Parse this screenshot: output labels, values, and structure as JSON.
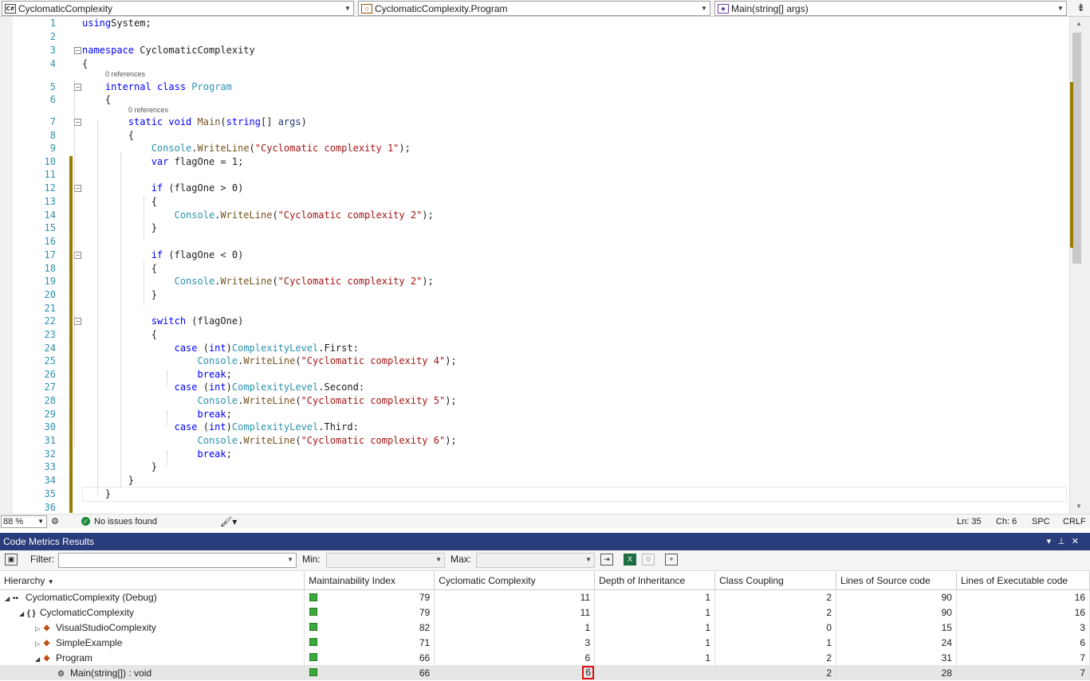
{
  "navbar": {
    "project": "CyclomaticComplexity",
    "project_icon": "C#",
    "type": "CyclomaticComplexity.Program",
    "member": "Main(string[] args)"
  },
  "code": {
    "reference_label": "0 references",
    "lines": [
      {
        "n": "1",
        "t": [
          [
            "kw",
            "using"
          ],
          [
            "",
            "System;"
          ]
        ]
      },
      {
        "n": "2",
        "t": []
      },
      {
        "n": "3",
        "t": [
          [
            "kw",
            "namespace"
          ],
          [
            "",
            " CyclomaticComplexity"
          ]
        ]
      },
      {
        "n": "4",
        "t": [
          [
            "",
            "{"
          ]
        ]
      },
      {
        "n": "5",
        "t": [
          [
            "",
            "    "
          ],
          [
            "kw",
            "internal class"
          ],
          [
            "",
            " "
          ],
          [
            "ty",
            "Program"
          ]
        ]
      },
      {
        "n": "6",
        "t": [
          [
            "",
            "    {"
          ]
        ]
      },
      {
        "n": "7",
        "t": [
          [
            "",
            "        "
          ],
          [
            "kw",
            "static void"
          ],
          [
            "",
            " "
          ],
          [
            "mt",
            "Main"
          ],
          [
            "",
            "("
          ],
          [
            "kw",
            "string"
          ],
          [
            "",
            "[] "
          ],
          [
            "pa",
            "args"
          ],
          [
            "",
            ")"
          ]
        ]
      },
      {
        "n": "8",
        "t": [
          [
            "",
            "        {"
          ]
        ]
      },
      {
        "n": "9",
        "t": [
          [
            "",
            "            "
          ],
          [
            "ty",
            "Console"
          ],
          [
            "",
            "."
          ],
          [
            "mt",
            "WriteLine"
          ],
          [
            "",
            "("
          ],
          [
            "st",
            "\"Cyclomatic complexity 1\""
          ],
          [
            "",
            ");"
          ]
        ]
      },
      {
        "n": "10",
        "t": [
          [
            "",
            "            "
          ],
          [
            "kw",
            "var"
          ],
          [
            "",
            " flagOne = 1;"
          ]
        ]
      },
      {
        "n": "11",
        "t": []
      },
      {
        "n": "12",
        "t": [
          [
            "",
            "            "
          ],
          [
            "kw",
            "if"
          ],
          [
            "",
            " (flagOne > 0)"
          ]
        ]
      },
      {
        "n": "13",
        "t": [
          [
            "",
            "            {"
          ]
        ]
      },
      {
        "n": "14",
        "t": [
          [
            "",
            "                "
          ],
          [
            "ty",
            "Console"
          ],
          [
            "",
            "."
          ],
          [
            "mt",
            "WriteLine"
          ],
          [
            "",
            "("
          ],
          [
            "st",
            "\"Cyclomatic complexity 2\""
          ],
          [
            "",
            ");"
          ]
        ]
      },
      {
        "n": "15",
        "t": [
          [
            "",
            "            }"
          ]
        ]
      },
      {
        "n": "16",
        "t": []
      },
      {
        "n": "17",
        "t": [
          [
            "",
            "            "
          ],
          [
            "kw",
            "if"
          ],
          [
            "",
            " (flagOne < 0)"
          ]
        ]
      },
      {
        "n": "18",
        "t": [
          [
            "",
            "            {"
          ]
        ]
      },
      {
        "n": "19",
        "t": [
          [
            "",
            "                "
          ],
          [
            "ty",
            "Console"
          ],
          [
            "",
            "."
          ],
          [
            "mt",
            "WriteLine"
          ],
          [
            "",
            "("
          ],
          [
            "st",
            "\"Cyclomatic complexity 2\""
          ],
          [
            "",
            ");"
          ]
        ]
      },
      {
        "n": "20",
        "t": [
          [
            "",
            "            }"
          ]
        ]
      },
      {
        "n": "21",
        "t": []
      },
      {
        "n": "22",
        "t": [
          [
            "",
            "            "
          ],
          [
            "kw",
            "switch"
          ],
          [
            "",
            " (flagOne)"
          ]
        ]
      },
      {
        "n": "23",
        "t": [
          [
            "",
            "            {"
          ]
        ]
      },
      {
        "n": "24",
        "t": [
          [
            "",
            "                "
          ],
          [
            "kw",
            "case"
          ],
          [
            "",
            " ("
          ],
          [
            "kw",
            "int"
          ],
          [
            "",
            ")"
          ],
          [
            "ty",
            "ComplexityLevel"
          ],
          [
            "",
            ".First:"
          ]
        ]
      },
      {
        "n": "25",
        "t": [
          [
            "",
            "                    "
          ],
          [
            "ty",
            "Console"
          ],
          [
            "",
            "."
          ],
          [
            "mt",
            "WriteLine"
          ],
          [
            "",
            "("
          ],
          [
            "st",
            "\"Cyclomatic complexity 4\""
          ],
          [
            "",
            ");"
          ]
        ]
      },
      {
        "n": "26",
        "t": [
          [
            "",
            "                    "
          ],
          [
            "kw",
            "break"
          ],
          [
            "",
            ";"
          ]
        ]
      },
      {
        "n": "27",
        "t": [
          [
            "",
            "                "
          ],
          [
            "kw",
            "case"
          ],
          [
            "",
            " ("
          ],
          [
            "kw",
            "int"
          ],
          [
            "",
            ")"
          ],
          [
            "ty",
            "ComplexityLevel"
          ],
          [
            "",
            ".Second:"
          ]
        ]
      },
      {
        "n": "28",
        "t": [
          [
            "",
            "                    "
          ],
          [
            "ty",
            "Console"
          ],
          [
            "",
            "."
          ],
          [
            "mt",
            "WriteLine"
          ],
          [
            "",
            "("
          ],
          [
            "st",
            "\"Cyclomatic complexity 5\""
          ],
          [
            "",
            ");"
          ]
        ]
      },
      {
        "n": "29",
        "t": [
          [
            "",
            "                    "
          ],
          [
            "kw",
            "break"
          ],
          [
            "",
            ";"
          ]
        ]
      },
      {
        "n": "30",
        "t": [
          [
            "",
            "                "
          ],
          [
            "kw",
            "case"
          ],
          [
            "",
            " ("
          ],
          [
            "kw",
            "int"
          ],
          [
            "",
            ")"
          ],
          [
            "ty",
            "ComplexityLevel"
          ],
          [
            "",
            ".Third:"
          ]
        ]
      },
      {
        "n": "31",
        "t": [
          [
            "",
            "                    "
          ],
          [
            "ty",
            "Console"
          ],
          [
            "",
            "."
          ],
          [
            "mt",
            "WriteLine"
          ],
          [
            "",
            "("
          ],
          [
            "st",
            "\"Cyclomatic complexity 6\""
          ],
          [
            "",
            ");"
          ]
        ]
      },
      {
        "n": "32",
        "t": [
          [
            "",
            "                    "
          ],
          [
            "kw",
            "break"
          ],
          [
            "",
            ";"
          ]
        ]
      },
      {
        "n": "33",
        "t": [
          [
            "",
            "            }"
          ]
        ]
      },
      {
        "n": "34",
        "t": [
          [
            "",
            "        }"
          ]
        ]
      },
      {
        "n": "35",
        "t": [
          [
            "",
            "    }"
          ]
        ]
      },
      {
        "n": "36",
        "t": []
      }
    ]
  },
  "status": {
    "zoom": "88 %",
    "issues": "No issues found",
    "ln": "Ln: 35",
    "ch": "Ch: 6",
    "spc": "SPC",
    "crlf": "CRLF"
  },
  "panel": {
    "title": "Code Metrics Results",
    "filter_label": "Filter:",
    "min_label": "Min:",
    "max_label": "Max:"
  },
  "metrics": {
    "headers": [
      "Hierarchy",
      "Maintainability Index",
      "Cyclomatic Complexity",
      "Depth of Inheritance",
      "Class Coupling",
      "Lines of Source code",
      "Lines of Executable code"
    ],
    "rows": [
      {
        "name": "CyclomaticComplexity (Debug)",
        "icon": "project-icon",
        "expander": "expanded",
        "mi": "79",
        "cc": "11",
        "di": "1",
        "coupling": "2",
        "los": "90",
        "loe": "16"
      },
      {
        "name": "CyclomaticComplexity",
        "icon": "namespace-icon",
        "expander": "expanded",
        "mi": "79",
        "cc": "11",
        "di": "1",
        "coupling": "2",
        "los": "90",
        "loe": "16"
      },
      {
        "name": "VisualStudioComplexity",
        "icon": "class-icon",
        "expander": "collapsed",
        "mi": "82",
        "cc": "1",
        "di": "1",
        "coupling": "0",
        "los": "15",
        "loe": "3"
      },
      {
        "name": "SimpleExample",
        "icon": "class-icon",
        "expander": "collapsed",
        "mi": "71",
        "cc": "3",
        "di": "1",
        "coupling": "1",
        "los": "24",
        "loe": "6"
      },
      {
        "name": "Program",
        "icon": "class-icon",
        "expander": "expanded",
        "mi": "66",
        "cc": "6",
        "di": "1",
        "coupling": "2",
        "los": "31",
        "loe": "7"
      },
      {
        "name": "Main(string[]) : void",
        "icon": "method-icon",
        "expander": "none",
        "mi": "66",
        "cc": "6",
        "di": "",
        "coupling": "2",
        "los": "28",
        "loe": "7",
        "selected": true,
        "highlight_cc": true
      }
    ]
  }
}
